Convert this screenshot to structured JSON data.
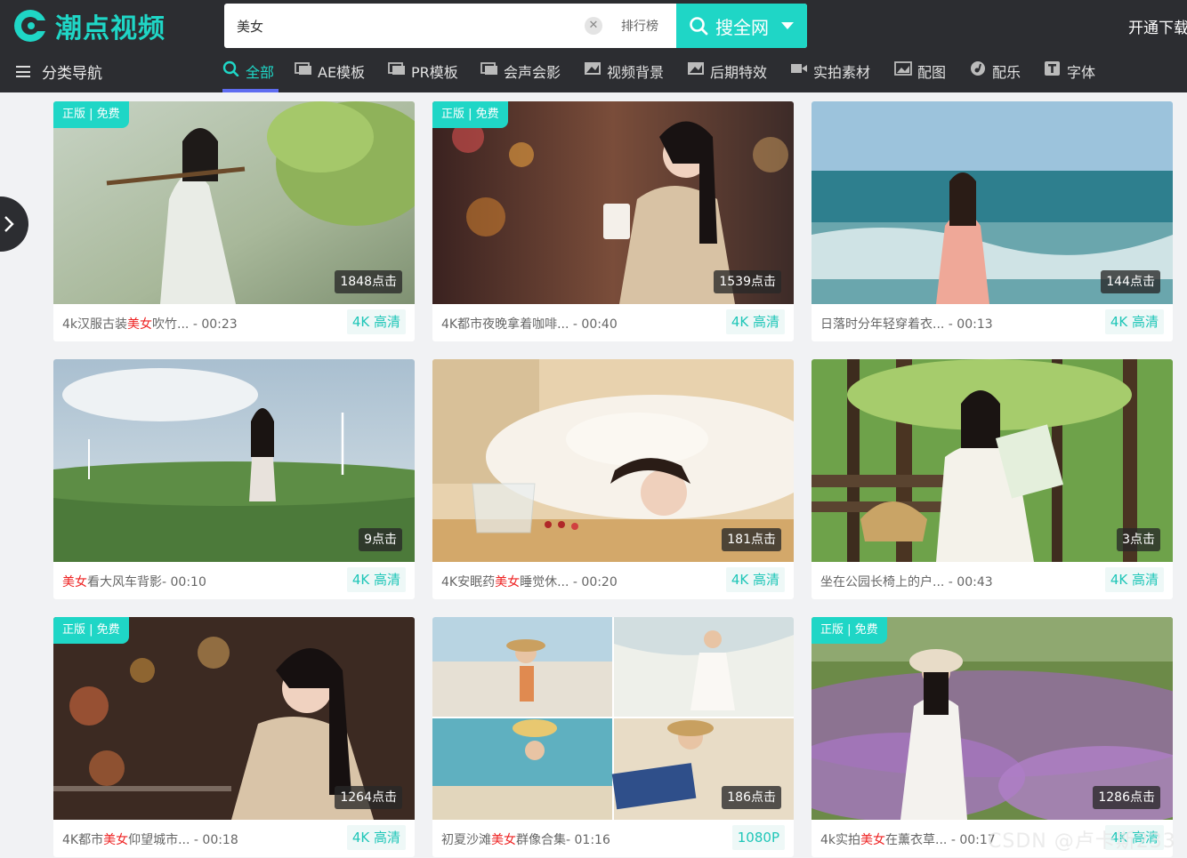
{
  "brand": {
    "name": "潮点视频",
    "accent": "#1fd6c6",
    "header_bg": "#2c2d31"
  },
  "search": {
    "value": "美女",
    "clear_icon": "close-icon",
    "rank_label": "排行榜",
    "button_label": "搜全网"
  },
  "header": {
    "vip_label": "开通下载"
  },
  "nav": {
    "category_label": "分类导航",
    "items": [
      {
        "label": "全部",
        "icon": "search-icon",
        "active": true
      },
      {
        "label": "AE模板",
        "icon": "ae-icon"
      },
      {
        "label": "PR模板",
        "icon": "pr-icon"
      },
      {
        "label": "会声会影",
        "icon": "vs-icon"
      },
      {
        "label": "视频背景",
        "icon": "video-bg-icon"
      },
      {
        "label": "后期特效",
        "icon": "effects-icon"
      },
      {
        "label": "实拍素材",
        "icon": "camera-icon"
      },
      {
        "label": "配图",
        "icon": "image-icon"
      },
      {
        "label": "配乐",
        "icon": "music-icon"
      },
      {
        "label": "字体",
        "icon": "font-icon"
      }
    ]
  },
  "cards": [
    {
      "badge": "正版 | 免费",
      "clicks": "1848点击",
      "title_pre": "4k汉服古装",
      "title_hl": "美女",
      "title_post": "吹竹...",
      "duration": " - 00:23",
      "quality": "4K 高清"
    },
    {
      "badge": "正版 | 免费",
      "clicks": "1539点击",
      "title_pre": "4K都市夜晚拿着咖啡...",
      "title_hl": "",
      "title_post": "",
      "duration": " - 00:40",
      "quality": "4K 高清"
    },
    {
      "badge": "",
      "clicks": "144点击",
      "title_pre": "日落时分年轻穿着衣...",
      "title_hl": "",
      "title_post": "",
      "duration": " - 00:13",
      "quality": "4K 高清"
    },
    {
      "badge": "",
      "clicks": "9点击",
      "title_pre": "",
      "title_hl": "美女",
      "title_post": "看大风车背影",
      "duration": "- 00:10",
      "quality": "4K 高清"
    },
    {
      "badge": "",
      "clicks": "181点击",
      "title_pre": "4K安眠药",
      "title_hl": "美女",
      "title_post": "睡觉休...",
      "duration": " - 00:20",
      "quality": "4K 高清"
    },
    {
      "badge": "",
      "clicks": "3点击",
      "title_pre": "坐在公园长椅上的户...",
      "title_hl": "",
      "title_post": "",
      "duration": " - 00:43",
      "quality": "4K 高清"
    },
    {
      "badge": "正版 | 免费",
      "clicks": "1264点击",
      "title_pre": "4K都市",
      "title_hl": "美女",
      "title_post": "仰望城市...",
      "duration": " - 00:18",
      "quality": "4K 高清"
    },
    {
      "badge": "",
      "clicks": "186点击",
      "title_pre": "初夏沙滩",
      "title_hl": "美女",
      "title_post": "群像合集",
      "duration": "- 01:16",
      "quality": "1080P"
    },
    {
      "badge": "正版 | 免费",
      "clicks": "1286点击",
      "title_pre": "4k实拍",
      "title_hl": "美女",
      "title_post": "在薰衣草...",
      "duration": " - 00:17",
      "quality": "4K 高清"
    }
  ],
  "watermark": "CSDN @卢卡斯233"
}
